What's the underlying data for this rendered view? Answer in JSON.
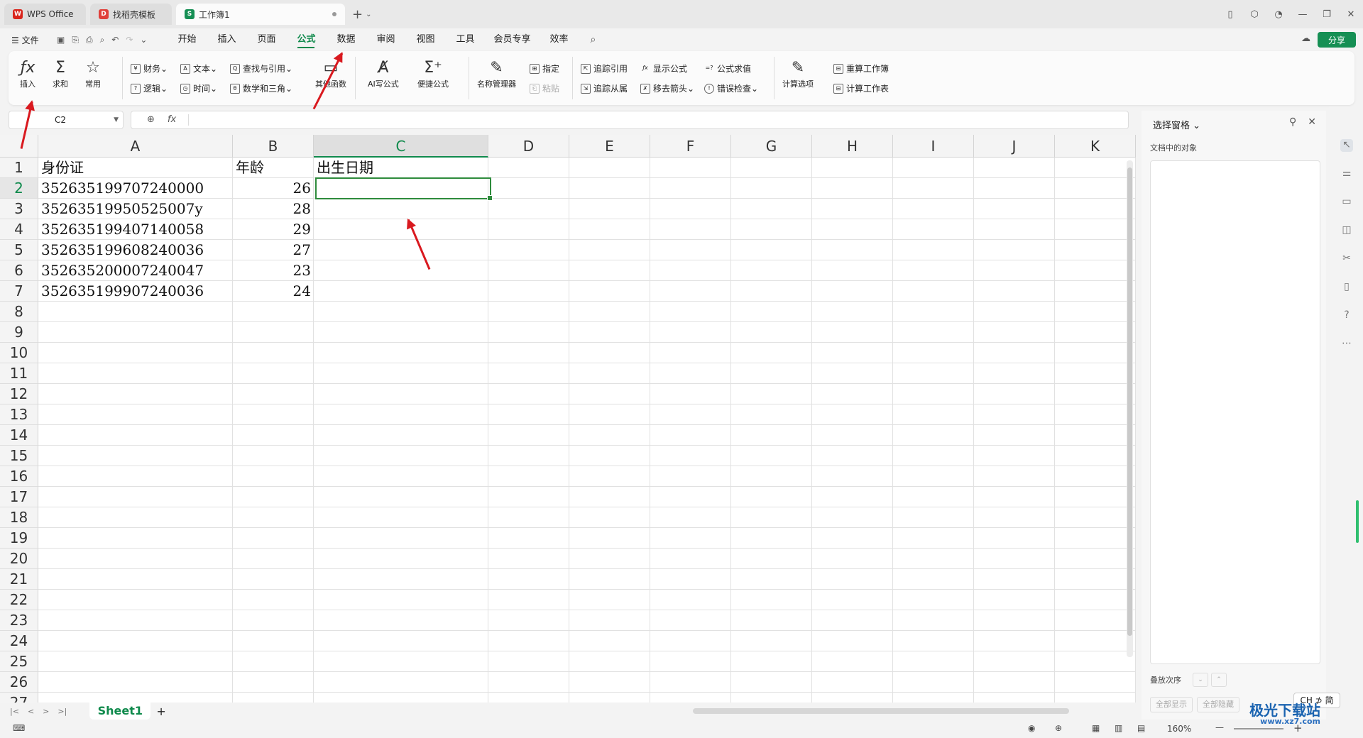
{
  "tabs": [
    {
      "label": "WPS Office",
      "icon": "wps-logo-icon",
      "color": "#d9251c"
    },
    {
      "label": "找稻壳模板",
      "icon": "docer-logo-icon",
      "color": "#e0403a"
    },
    {
      "label": "工作簿1",
      "icon": "sheet-logo-icon",
      "color": "#168f54"
    }
  ],
  "menubar": {
    "file": "☰ 文件",
    "items": [
      "开始",
      "插入",
      "页面",
      "公式",
      "数据",
      "审阅",
      "视图",
      "工具",
      "会员专享",
      "效率"
    ],
    "active": "公式",
    "share": "分享"
  },
  "ribbon": {
    "insert": "插入",
    "sum": "求和",
    "common": "常用",
    "finance": "财务",
    "text": "文本",
    "lookup": "查找与引用",
    "other_funcs": "其他函数",
    "logic": "逻辑",
    "time": "时间",
    "math": "数学和三角",
    "ai_formula": "AI写公式",
    "quick_formula": "便捷公式",
    "name_manager": "名称管理器",
    "specify": "指定",
    "paste": "粘贴",
    "trace_precedents": "追踪引用",
    "trace_dependents": "追踪从属",
    "show_formulas": "显示公式",
    "remove_arrows": "移去箭头",
    "evaluate": "公式求值",
    "error_check": "错误检查",
    "calc_options": "计算选项",
    "recalc_workbook": "重算工作簿",
    "calc_sheet": "计算工作表"
  },
  "formula": {
    "name_box": "C2",
    "fx": "fx",
    "content": ""
  },
  "columns": [
    "A",
    "B",
    "C",
    "D",
    "E",
    "F",
    "G",
    "H",
    "I",
    "J",
    "K"
  ],
  "selected_column": "C",
  "rows": [
    "1",
    "2",
    "3",
    "4",
    "5",
    "6",
    "7",
    "8",
    "9",
    "10",
    "11",
    "12",
    "13",
    "14",
    "15",
    "16",
    "17",
    "18",
    "19",
    "20",
    "21",
    "22",
    "23",
    "24",
    "25",
    "26",
    "27"
  ],
  "selected_row": "2",
  "cells": {
    "A1": "身份证",
    "B1": "年龄",
    "C1": "出生日期",
    "A2": "352635199707240000",
    "B2": "26",
    "A3": "35263519950525007y",
    "B3": "28",
    "A4": "352635199407140058",
    "B4": "29",
    "A5": "352635199608240036",
    "B5": "27",
    "A6": "352635200007240047",
    "B6": "23",
    "A7": "352635199907240036",
    "B7": "24"
  },
  "sheet_tab": "Sheet1",
  "status": {
    "zoom": "160%"
  },
  "panel": {
    "title": "选择窗格",
    "subtitle": "文档中的对象",
    "stack_order": "叠放次序",
    "show_all": "全部显示",
    "hide_all": "全部隐藏"
  },
  "ime": "CH ⊅ 简",
  "watermark": {
    "name": "极光下载站",
    "url": "www.xz7.com"
  },
  "colors": {
    "accent": "#0f8a4c",
    "share": "#168f54",
    "arrow": "#d9191f",
    "selection": "#2e8b3c"
  }
}
